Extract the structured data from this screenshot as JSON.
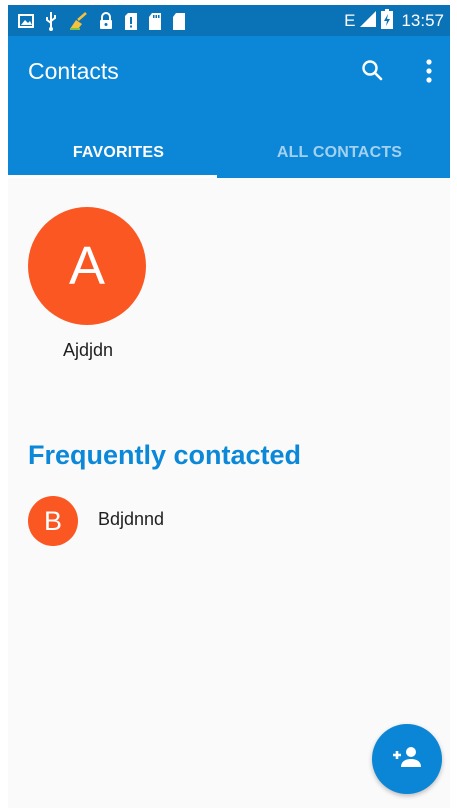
{
  "status_bar": {
    "icons_left": [
      "image-icon",
      "usb-icon",
      "cleaner-icon",
      "lock-icon",
      "alert-sim-icon",
      "sd-card-icon",
      "sd-card-icon"
    ],
    "network_type": "E",
    "time": "13:57"
  },
  "app_bar": {
    "title": "Contacts",
    "search_icon": "search-icon",
    "more_icon": "more-vert-icon"
  },
  "tabs": [
    {
      "label": "FAVORITES",
      "selected": true
    },
    {
      "label": "ALL CONTACTS",
      "selected": false
    }
  ],
  "favorites": [
    {
      "initial": "A",
      "name": "Ajdjdn",
      "color": "#fb5722"
    }
  ],
  "frequently_contacted": {
    "title": "Frequently contacted",
    "items": [
      {
        "initial": "B",
        "name": "Bdjdnnd",
        "color": "#fb5722"
      }
    ]
  },
  "fab": {
    "icon": "add-person-icon"
  },
  "colors": {
    "status_bar": "#0a73b8",
    "app_bar": "#0c87d7",
    "accent": "#0b88d8",
    "avatar": "#fb5722"
  }
}
